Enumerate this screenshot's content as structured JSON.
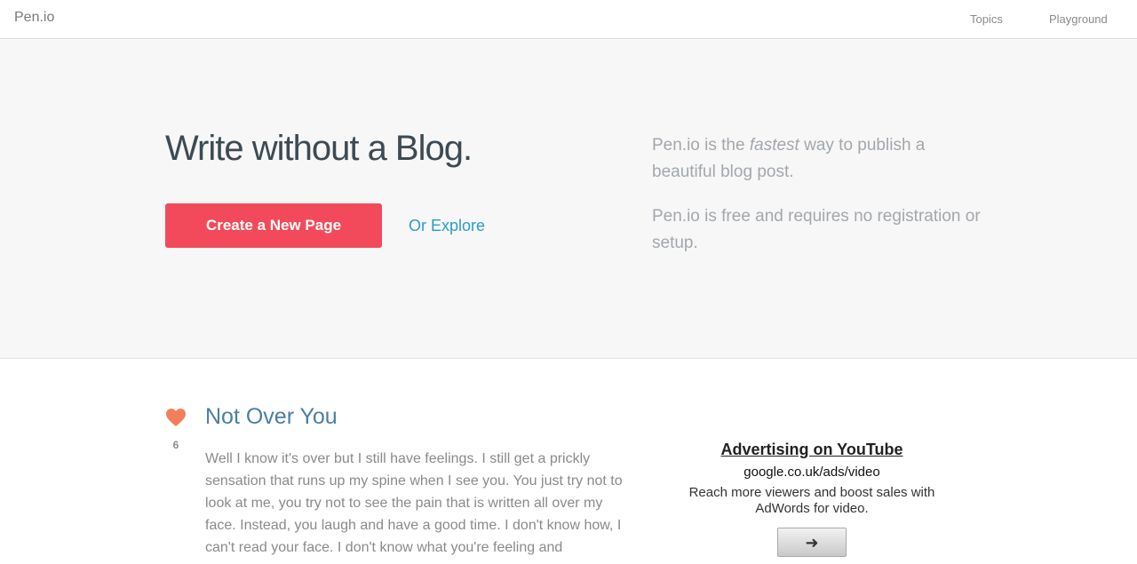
{
  "header": {
    "logo": "Pen.io",
    "nav": {
      "topics": "Topics",
      "playground": "Playground"
    }
  },
  "hero": {
    "title": "Write without a Blog.",
    "create_button": "Create a New Page",
    "explore_link": "Or Explore",
    "desc1": {
      "before": "Pen.io is the ",
      "emphasis": "fastest",
      "after": " way to publish a beautiful blog post."
    },
    "desc2": "Pen.io is free and requires no registration or setup."
  },
  "post": {
    "likes": "6",
    "title": "Not Over You",
    "body": "Well I know it's over but I still have feelings. I still get a prickly sensation that runs up my spine when I see you. You just try not to look at me, you try not to see the pain that is written all over my face. Instead, you laugh and have a good time. I don't know how, I can't read your face. I don't know what you're feeling and"
  },
  "ad": {
    "title": "Advertising on YouTube",
    "url": "google.co.uk/ads/video",
    "text": "Reach more viewers and boost sales with AdWords for video.",
    "button_icon": "arrow-right-icon"
  },
  "colors": {
    "accent": "#f24a5a",
    "link": "#2a9fc4",
    "heart": "#f47e5c",
    "post_title": "#4a7fa3"
  }
}
